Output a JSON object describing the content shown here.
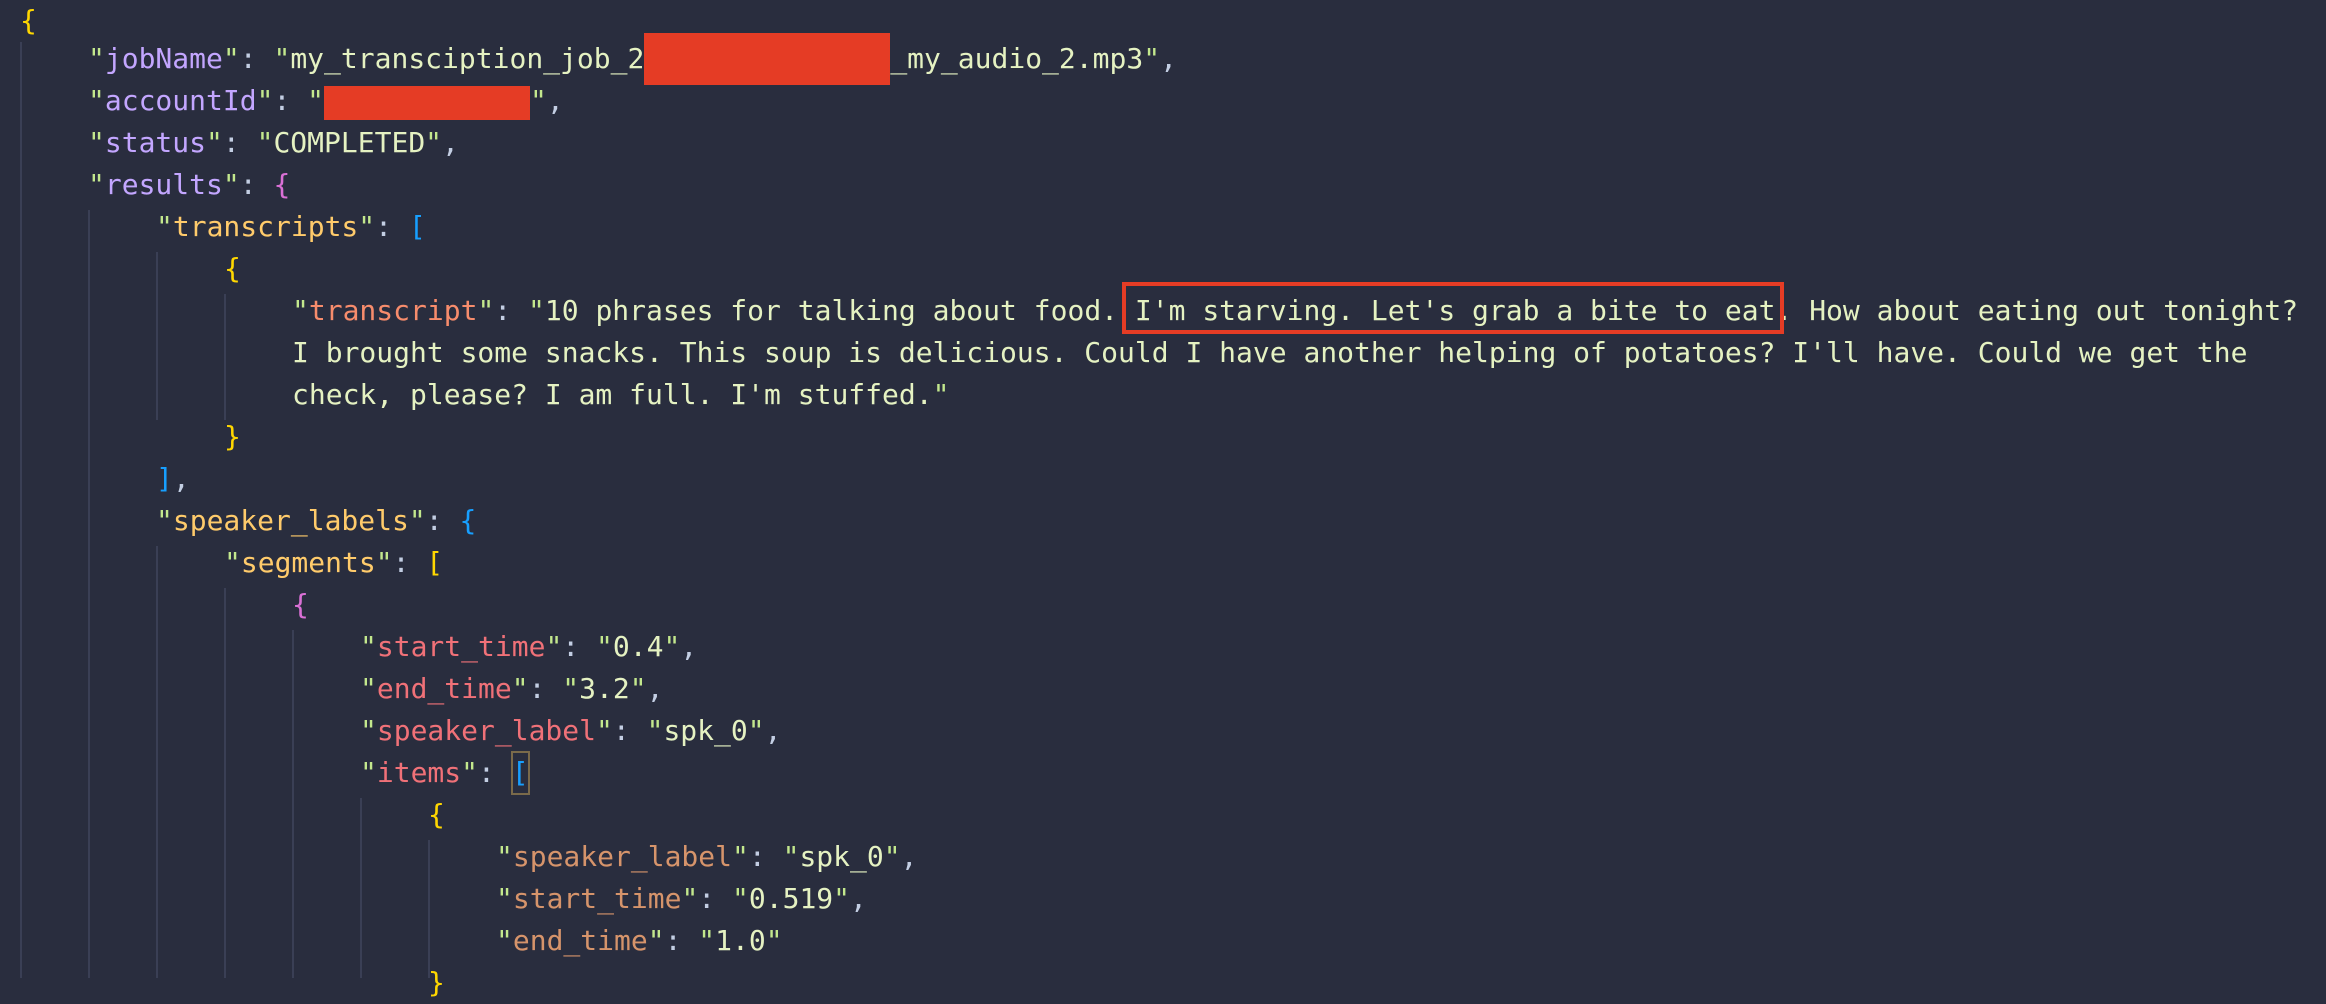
{
  "code": {
    "open_brace": "{",
    "jobName_key": "jobName",
    "jobName_prefix": "my_transciption_job_2",
    "jobName_suffix": "_my_audio_2.mp3",
    "accountId_key": "accountId",
    "status_key": "status",
    "status_value": "COMPLETED",
    "results_key": "results",
    "transcripts_key": "transcripts",
    "transcript_key": "transcript",
    "transcript_line1_a": "10 phrases for talking about food. ",
    "transcript_line1_highlight": "I'm starving. Let's grab a bite to eat.",
    "transcript_line1_b": " How about eating out tonight?",
    "transcript_line2": "I brought some snacks. This soup is delicious. Could I have another helping of potatoes? I'll have. Could we get the",
    "transcript_line3": "check, please? I am full. I'm stuffed.",
    "speaker_labels_key": "speaker_labels",
    "segments_key": "segments",
    "start_time_key": "start_time",
    "start_time_value": "0.4",
    "end_time_key": "end_time",
    "end_time_value": "3.2",
    "speaker_label_key": "speaker_label",
    "speaker_label_value": "spk_0",
    "items_key": "items",
    "item_speaker_label_key": "speaker_label",
    "item_speaker_label_value": "spk_0",
    "item_start_time_key": "start_time",
    "item_start_time_value": "0.519",
    "item_end_time_key": "end_time",
    "item_end_time_value": "1.0"
  },
  "colors": {
    "background": "#292d3e",
    "redaction": "#e53c25",
    "highlight_border": "#e53c25"
  }
}
